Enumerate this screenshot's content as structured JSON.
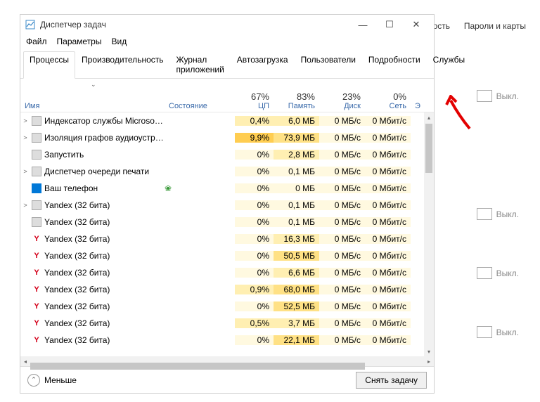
{
  "bg": {
    "top_link": "Пароли и карты",
    "exit_label": "ость",
    "toggle_label": "Выкл."
  },
  "window": {
    "title": "Диспетчер задач"
  },
  "menu": {
    "file": "Файл",
    "options": "Параметры",
    "view": "Вид"
  },
  "tabs": [
    "Процессы",
    "Производительность",
    "Журнал приложений",
    "Автозагрузка",
    "Пользователи",
    "Подробности",
    "Службы"
  ],
  "headers": {
    "name": "Имя",
    "state": "Состояние",
    "cpu_pct": "67%",
    "cpu": "ЦП",
    "mem_pct": "83%",
    "mem": "Память",
    "disk_pct": "23%",
    "disk": "Диск",
    "net_pct": "0%",
    "net": "Сеть",
    "extra": "Э"
  },
  "rows": [
    {
      "exp": ">",
      "icon": "generic",
      "name": "Индексатор службы Microsoft ...",
      "state": "",
      "cpu": "0,4%",
      "cpu_h": 1,
      "mem": "6,0 МБ",
      "mem_h": 1,
      "disk": "0 МБ/с",
      "net": "0 Мбит/с"
    },
    {
      "exp": ">",
      "icon": "generic",
      "name": "Изоляция графов аудиоустро...",
      "state": "",
      "cpu": "9,9%",
      "cpu_h": 3,
      "mem": "73,9 МБ",
      "mem_h": 2,
      "disk": "0 МБ/с",
      "net": "0 Мбит/с"
    },
    {
      "exp": "",
      "icon": "generic",
      "name": "Запустить",
      "state": "",
      "cpu": "0%",
      "cpu_h": 0,
      "mem": "2,8 МБ",
      "mem_h": 1,
      "disk": "0 МБ/с",
      "net": "0 Мбит/с"
    },
    {
      "exp": ">",
      "icon": "generic",
      "name": "Диспетчер очереди печати",
      "state": "",
      "cpu": "0%",
      "cpu_h": 0,
      "mem": "0,1 МБ",
      "mem_h": 0,
      "disk": "0 МБ/с",
      "net": "0 Мбит/с"
    },
    {
      "exp": "",
      "icon": "phone",
      "name": "Ваш телефон",
      "state": "leaf",
      "cpu": "0%",
      "cpu_h": 0,
      "mem": "0 МБ",
      "mem_h": 0,
      "disk": "0 МБ/с",
      "net": "0 Мбит/с"
    },
    {
      "exp": ">",
      "icon": "generic",
      "name": "Yandex (32 бита)",
      "state": "",
      "cpu": "0%",
      "cpu_h": 0,
      "mem": "0,1 МБ",
      "mem_h": 0,
      "disk": "0 МБ/с",
      "net": "0 Мбит/с"
    },
    {
      "exp": "",
      "icon": "generic",
      "name": "Yandex (32 бита)",
      "state": "",
      "cpu": "0%",
      "cpu_h": 0,
      "mem": "0,1 МБ",
      "mem_h": 0,
      "disk": "0 МБ/с",
      "net": "0 Мбит/с"
    },
    {
      "exp": "",
      "icon": "yandex",
      "name": "Yandex (32 бита)",
      "state": "",
      "cpu": "0%",
      "cpu_h": 0,
      "mem": "16,3 МБ",
      "mem_h": 1,
      "disk": "0 МБ/с",
      "net": "0 Мбит/с"
    },
    {
      "exp": "",
      "icon": "yandex",
      "name": "Yandex (32 бита)",
      "state": "",
      "cpu": "0%",
      "cpu_h": 0,
      "mem": "50,5 МБ",
      "mem_h": 2,
      "disk": "0 МБ/с",
      "net": "0 Мбит/с"
    },
    {
      "exp": "",
      "icon": "yandex",
      "name": "Yandex (32 бита)",
      "state": "",
      "cpu": "0%",
      "cpu_h": 0,
      "mem": "6,6 МБ",
      "mem_h": 1,
      "disk": "0 МБ/с",
      "net": "0 Мбит/с"
    },
    {
      "exp": "",
      "icon": "yandex",
      "name": "Yandex (32 бита)",
      "state": "",
      "cpu": "0,9%",
      "cpu_h": 1,
      "mem": "68,0 МБ",
      "mem_h": 2,
      "disk": "0 МБ/с",
      "net": "0 Мбит/с"
    },
    {
      "exp": "",
      "icon": "yandex",
      "name": "Yandex (32 бита)",
      "state": "",
      "cpu": "0%",
      "cpu_h": 0,
      "mem": "52,5 МБ",
      "mem_h": 2,
      "disk": "0 МБ/с",
      "net": "0 Мбит/с"
    },
    {
      "exp": "",
      "icon": "yandex",
      "name": "Yandex (32 бита)",
      "state": "",
      "cpu": "0,5%",
      "cpu_h": 1,
      "mem": "3,7 МБ",
      "mem_h": 1,
      "disk": "0 МБ/с",
      "net": "0 Мбит/с"
    },
    {
      "exp": "",
      "icon": "yandex",
      "name": "Yandex (32 бита)",
      "state": "",
      "cpu": "0%",
      "cpu_h": 0,
      "mem": "22,1 МБ",
      "mem_h": 2,
      "disk": "0 МБ/с",
      "net": "0 Мбит/с"
    }
  ],
  "footer": {
    "less": "Меньше",
    "end_task": "Снять задачу"
  }
}
